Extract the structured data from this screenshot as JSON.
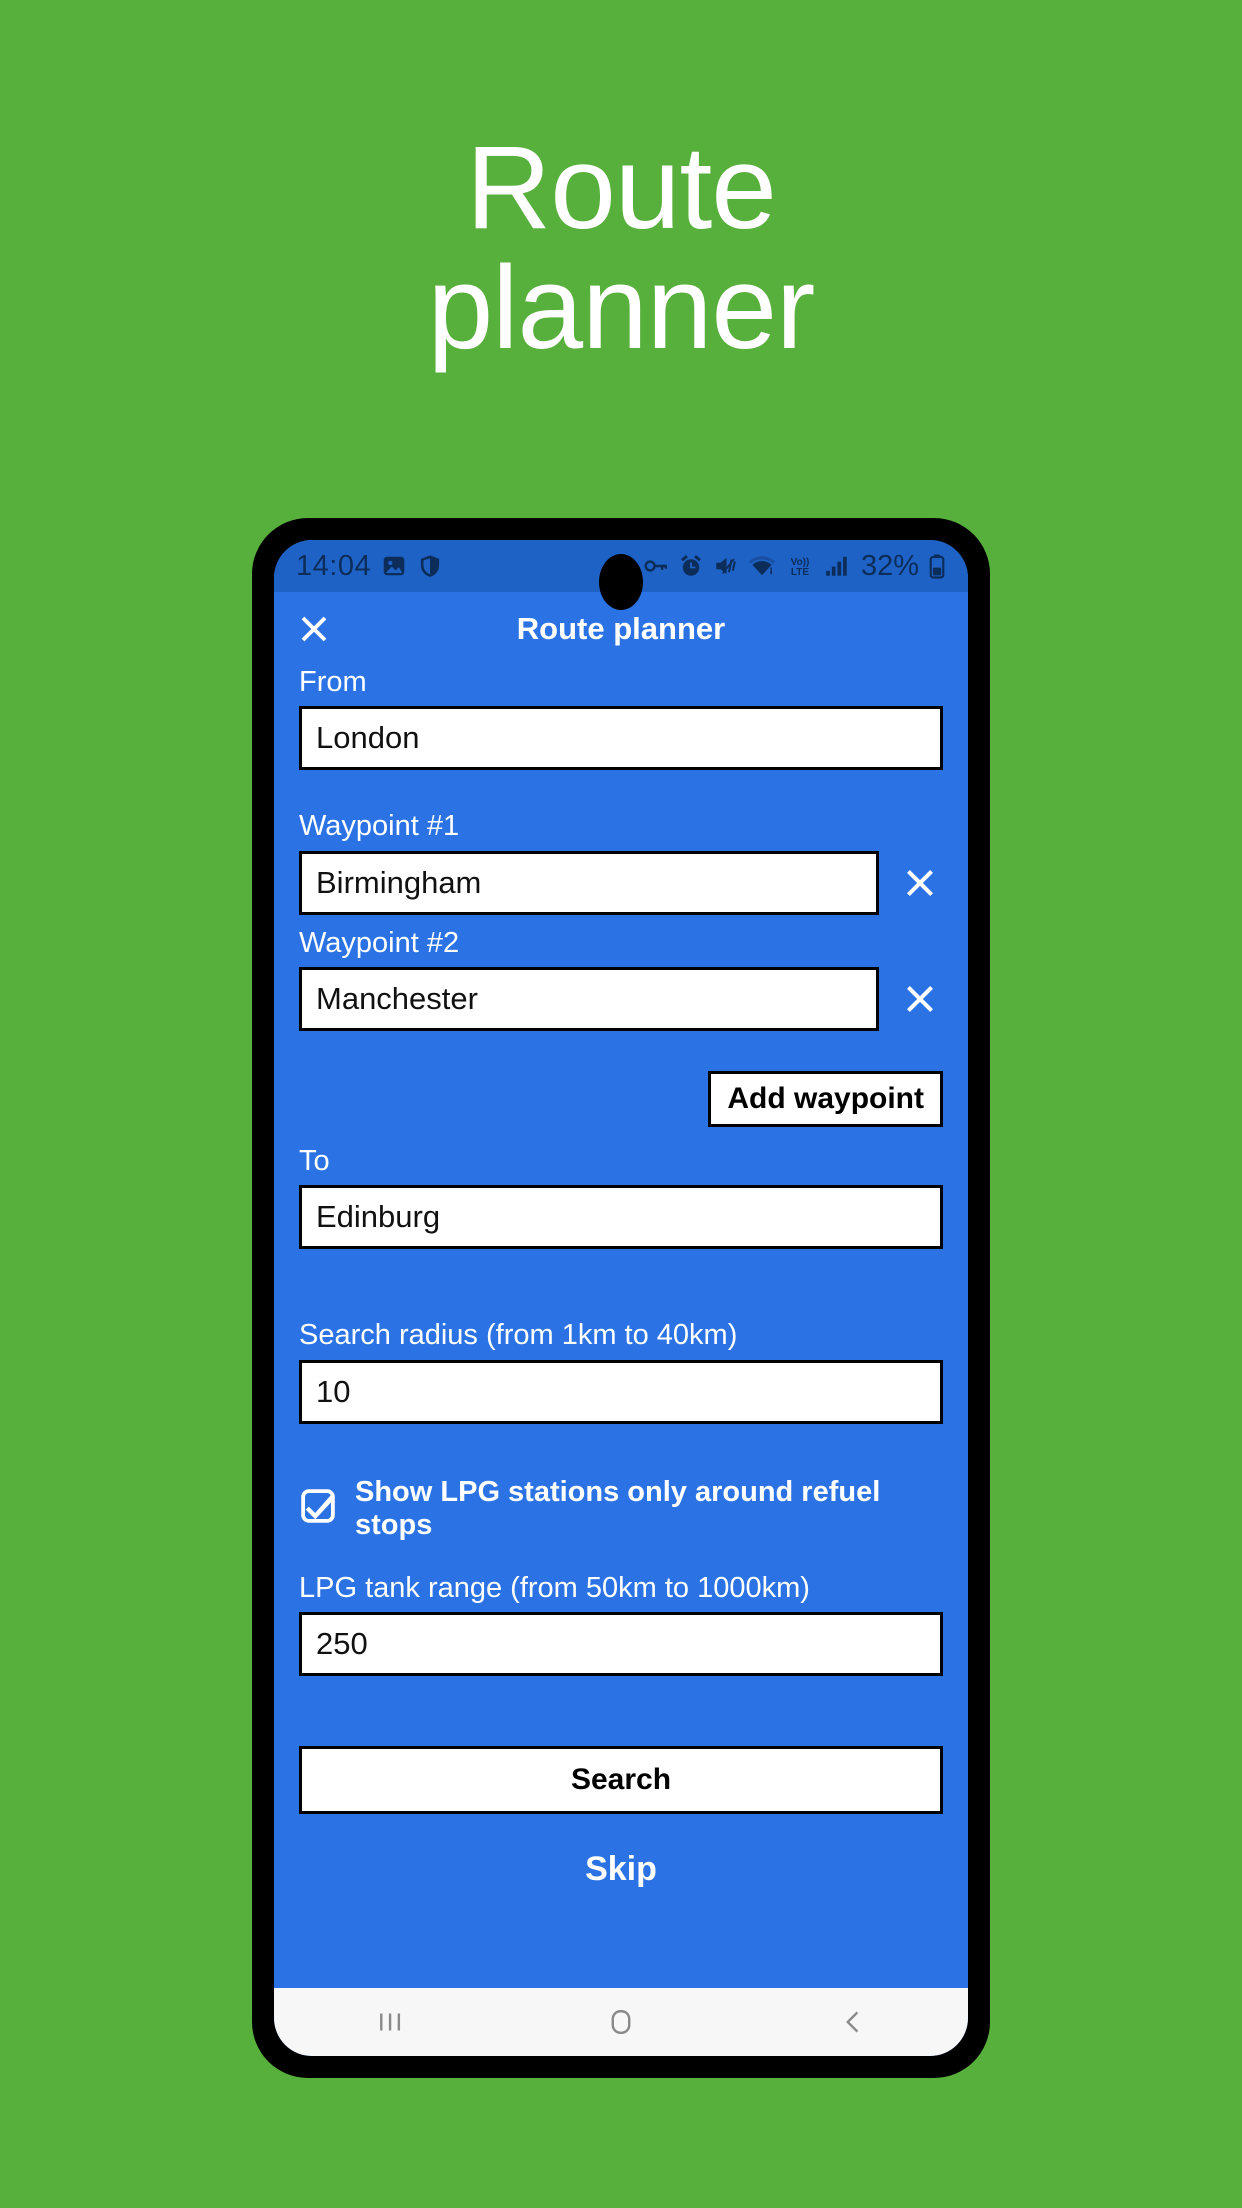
{
  "hero": {
    "title": "Route\nplanner"
  },
  "colors": {
    "background_green": "#57AF3C",
    "app_blue": "#2B73E5",
    "status_bar_blue": "#1F62C6",
    "frame_black": "#000000",
    "navbar_grey": "#F7F7F7"
  },
  "status_bar": {
    "time": "14:04",
    "battery_percent": "32%",
    "left_icons": [
      "photo-icon",
      "shield-icon"
    ],
    "right_icons": [
      "vpn-key-icon",
      "alarm-icon",
      "mute-icon",
      "wifi-icon",
      "volte-icon",
      "signal-icon",
      "battery-icon"
    ]
  },
  "appbar": {
    "close_label": "×",
    "title": "Route planner"
  },
  "form": {
    "from": {
      "label": "From",
      "value": "London"
    },
    "waypoints": [
      {
        "label": "Waypoint #1",
        "value": "Birmingham",
        "remove_label": "×"
      },
      {
        "label": "Waypoint #2",
        "value": "Manchester",
        "remove_label": "×"
      }
    ],
    "add_waypoint_label": "Add waypoint",
    "to": {
      "label": "To",
      "value": "Edinburg"
    },
    "search_radius": {
      "label": "Search radius (from 1km to 40km)",
      "value": "10"
    },
    "show_lpg_checkbox": {
      "label": "Show LPG stations only around refuel stops",
      "checked": true
    },
    "lpg_tank_range": {
      "label": "LPG tank range (from 50km to 1000km)",
      "value": "250"
    },
    "search_button_label": "Search",
    "skip_label": "Skip"
  },
  "navbar": {
    "recents_label": "recents-icon",
    "home_label": "home-icon",
    "back_label": "back-icon"
  }
}
